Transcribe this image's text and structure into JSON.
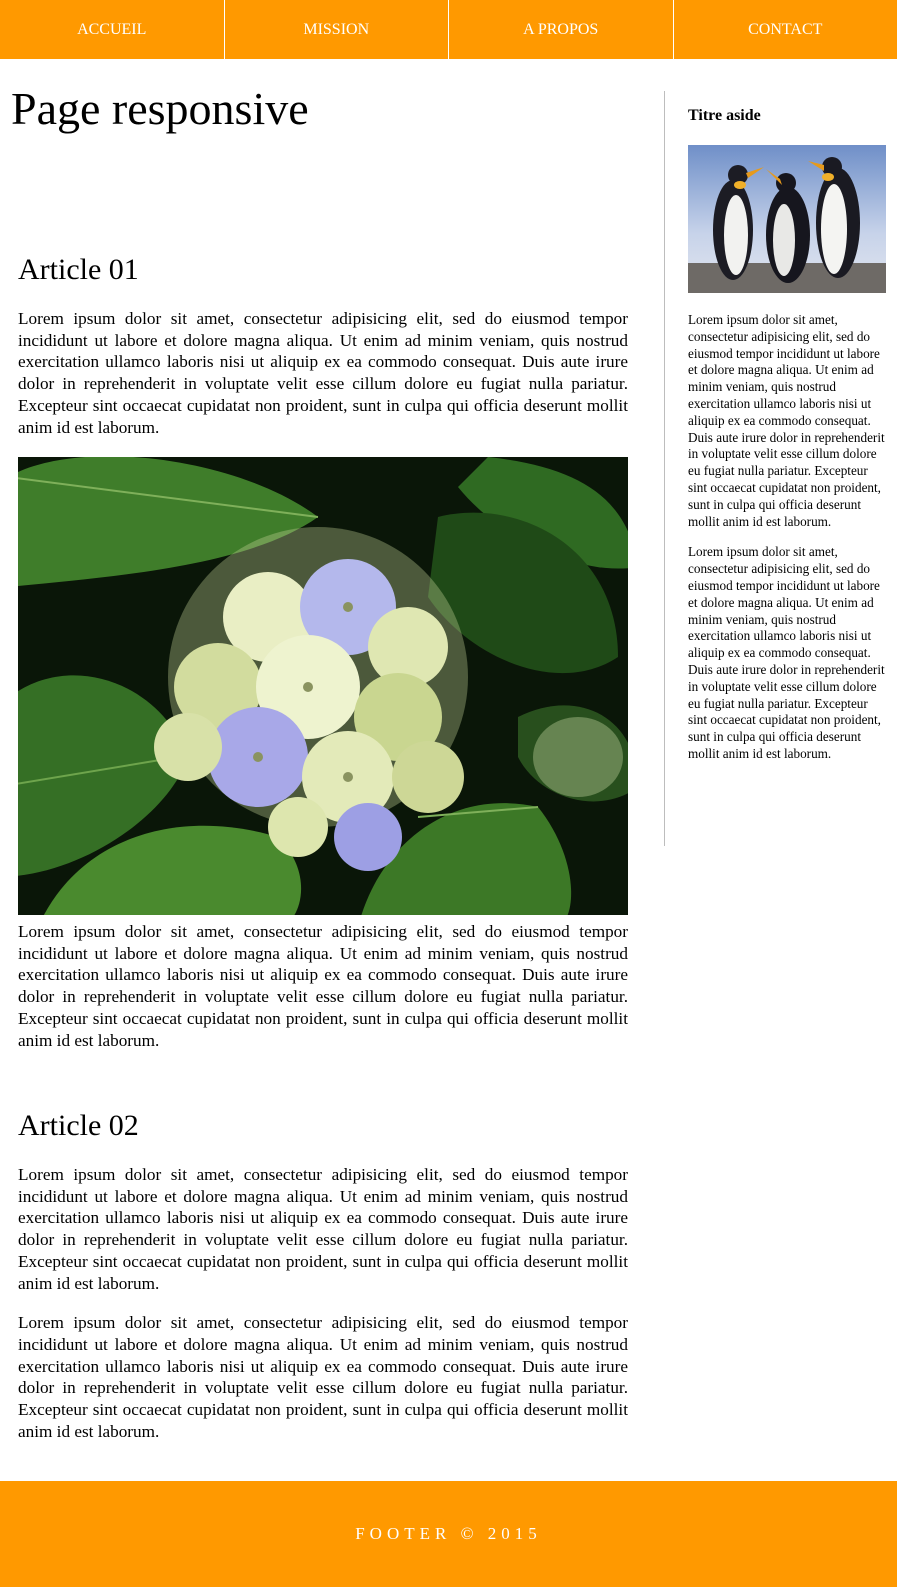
{
  "nav": {
    "items": [
      {
        "label": "ACCUEIL"
      },
      {
        "label": "MISSION"
      },
      {
        "label": "A PROPOS"
      },
      {
        "label": "CONTACT"
      }
    ]
  },
  "main": {
    "title": "Page responsive",
    "articles": [
      {
        "heading": "Article 01",
        "paragraphs": [
          "Lorem ipsum dolor sit amet, consectetur adipisicing elit, sed do eiusmod tempor incididunt ut labore et dolore magna aliqua. Ut enim ad minim veniam, quis nostrud exercitation ullamco laboris nisi ut aliquip ex ea commodo consequat. Duis aute irure dolor in reprehenderit in voluptate velit esse cillum dolore eu fugiat nulla pariatur. Excepteur sint occaecat cupidatat non proident, sunt in culpa qui officia deserunt mollit anim id est laborum.",
          "Lorem ipsum dolor sit amet, consectetur adipisicing elit, sed do eiusmod tempor incididunt ut labore et dolore magna aliqua. Ut enim ad minim veniam, quis nostrud exercitation ullamco laboris nisi ut aliquip ex ea commodo consequat. Duis aute irure dolor in reprehenderit in voluptate velit esse cillum dolore eu fugiat nulla pariatur. Excepteur sint occaecat cupidatat non proident, sunt in culpa qui officia deserunt mollit anim id est laborum."
        ]
      },
      {
        "heading": "Article 02",
        "paragraphs": [
          "Lorem ipsum dolor sit amet, consectetur adipisicing elit, sed do eiusmod tempor incididunt ut labore et dolore magna aliqua. Ut enim ad minim veniam, quis nostrud exercitation ullamco laboris nisi ut aliquip ex ea commodo consequat. Duis aute irure dolor in reprehenderit in voluptate velit esse cillum dolore eu fugiat nulla pariatur. Excepteur sint occaecat cupidatat non proident, sunt in culpa qui officia deserunt mollit anim id est laborum.",
          "Lorem ipsum dolor sit amet, consectetur adipisicing elit, sed do eiusmod tempor incididunt ut labore et dolore magna aliqua. Ut enim ad minim veniam, quis nostrud exercitation ullamco laboris nisi ut aliquip ex ea commodo consequat. Duis aute irure dolor in reprehenderit in voluptate velit esse cillum dolore eu fugiat nulla pariatur. Excepteur sint occaecat cupidatat non proident, sunt in culpa qui officia deserunt mollit anim id est laborum."
        ]
      }
    ]
  },
  "aside": {
    "title": "Titre aside",
    "paragraphs": [
      "Lorem ipsum dolor sit amet, consectetur adipisicing elit, sed do eiusmod tempor incididunt ut labore et dolore magna aliqua. Ut enim ad minim veniam, quis nostrud exercitation ullamco laboris nisi ut aliquip ex ea commodo consequat. Duis aute irure dolor in reprehenderit in voluptate velit esse cillum dolore eu fugiat nulla pariatur. Excepteur sint occaecat cupidatat non proident, sunt in culpa qui officia deserunt mollit anim id est laborum.",
      "Lorem ipsum dolor sit amet, consectetur adipisicing elit, sed do eiusmod tempor incididunt ut labore et dolore magna aliqua. Ut enim ad minim veniam, quis nostrud exercitation ullamco laboris nisi ut aliquip ex ea commodo consequat. Duis aute irure dolor in reprehenderit in voluptate velit esse cillum dolore eu fugiat nulla pariatur. Excepteur sint occaecat cupidatat non proident, sunt in culpa qui officia deserunt mollit anim id est laborum."
    ]
  },
  "footer": {
    "text": "FOOTER © 2015"
  },
  "colors": {
    "accent": "#ff9900",
    "divider": "#bdbdbd"
  },
  "icons": [
    "flower-photo",
    "penguins-photo"
  ]
}
